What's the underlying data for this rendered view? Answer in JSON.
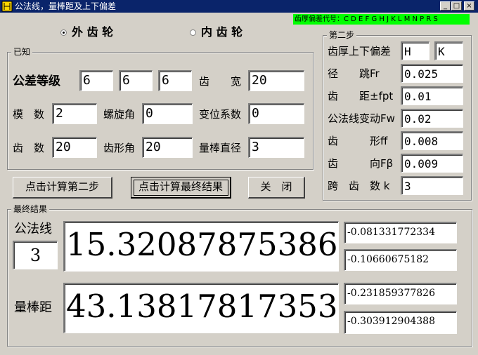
{
  "window": {
    "title": "公法线，量棒距及上下偏差",
    "min_btn": "_",
    "max_btn": "□",
    "close_btn": "×",
    "codes_label": "齿厚偏差代号：C D E F G H J K L M N P R S"
  },
  "gear_type": {
    "outer_label": "外 齿 轮",
    "inner_label": "内 齿 轮",
    "selected": "outer"
  },
  "known": {
    "title": "已知",
    "tolerance_grade_label": "公差等级",
    "tolerance_grade_1": "6",
    "tolerance_grade_2": "6",
    "tolerance_grade_3": "6",
    "face_width_label": "齿　　宽",
    "face_width": "20",
    "module_label": "模　数",
    "module": "2",
    "helix_angle_label": "螺旋角",
    "helix_angle": "0",
    "shift_coef_label": "变位系数",
    "shift_coef": "0",
    "teeth_label": "齿　数",
    "teeth": "20",
    "pressure_angle_label": "齿形角",
    "pressure_angle": "20",
    "pin_diameter_label": "量棒直径",
    "pin_diameter": "3"
  },
  "step2": {
    "title": "第二步",
    "thickness_dev_label": "齿厚上下偏差",
    "thickness_upper": "H",
    "thickness_lower": "K",
    "runout_label": "径　　跳Fr",
    "runout": "0.025",
    "pitch_label": "齿　　距±fpt",
    "pitch": "0.01",
    "wk_var_label": "公法线变动Fw",
    "wk_var": "0.02",
    "profile_label": "齿　　　形ff",
    "profile": "0.008",
    "helix_label": "齿　　　向Fβ",
    "helix": "0.009",
    "span_label": "跨　齿　数 k",
    "span": "3"
  },
  "buttons": {
    "calc_step2": "点击计算第二步",
    "calc_final": "点击计算最终结果",
    "close": "关　闭"
  },
  "result": {
    "title": "最终结果",
    "wk_label": "公法线",
    "wk_span": "3",
    "wk_value": "15.32087875386",
    "wk_upper": "-0.081331772334",
    "wk_lower": "-0.10660675182",
    "m_label": "量棒距",
    "m_value": "43.13817817353",
    "m_upper": "-0.231859377826",
    "m_lower": "-0.303912904388"
  }
}
